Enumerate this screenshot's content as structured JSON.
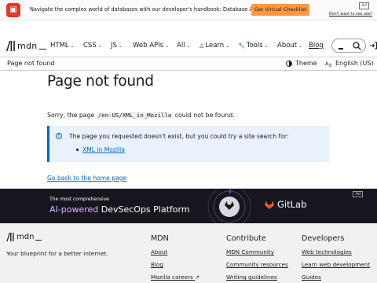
{
  "ad_banner": {
    "message": "Navigate the complex world of databases with our developer's handbook: Database Advice Guide",
    "cta": "Get Virtual Checklist",
    "ad_label": "Ad",
    "no_ads": "Don't want to see ads?"
  },
  "nav": {
    "logo_text": "mdn",
    "items": [
      {
        "label": "HTML"
      },
      {
        "label": "CSS"
      },
      {
        "label": "JS"
      },
      {
        "label": "Web APIs"
      },
      {
        "label": "All"
      },
      {
        "label": "Learn"
      },
      {
        "label": "Tools"
      },
      {
        "label": "About"
      },
      {
        "label": "Blog"
      }
    ]
  },
  "toolbar": {
    "breadcrumb": "Page not found",
    "theme": "Theme",
    "language": "English (US)"
  },
  "content": {
    "title": "Page not found",
    "sorry_prefix": "Sorry, the page",
    "path": "/en-US/XML_in_Mozilla",
    "sorry_suffix": "could not be found.",
    "notice_text": "The page you requested doesn't exist, but you could try a site search for:",
    "search_suggestion": "XML in Mozilla",
    "home_link": "Go back to the home page"
  },
  "promo": {
    "eyebrow": "The most comprehensive",
    "headline_accent": "AI-powered",
    "headline_rest": "DevSecOps Platform",
    "brand": "GitLab",
    "ad_label": "Ad"
  },
  "footer": {
    "logo_text": "mdn",
    "tagline": "Your blueprint for a better internet.",
    "columns": [
      {
        "heading": "MDN",
        "links": [
          "About",
          "Blog",
          "Mozilla careers"
        ]
      },
      {
        "heading": "Contribute",
        "links": [
          "MDN Community",
          "Community resources",
          "Writing guidelines"
        ]
      },
      {
        "heading": "Developers",
        "links": [
          "Web technologies",
          "Learn web development",
          "Guides"
        ]
      }
    ]
  },
  "colors": {
    "link": "#0069c2",
    "notice_bg": "#e8f1fc",
    "promo_bg": "#17161f",
    "footer_bg": "#f2f1f1",
    "cta_bg": "#ff9840",
    "brand_red": "#dc382c"
  }
}
